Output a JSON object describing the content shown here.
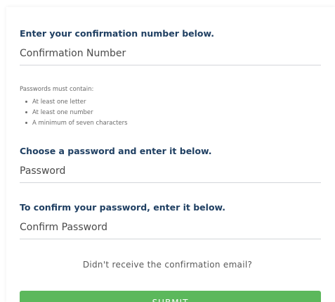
{
  "confirmation": {
    "heading": "Enter your confirmation number below.",
    "placeholder": "Confirmation Number",
    "value": ""
  },
  "password_rules": {
    "title": "Passwords must contain:",
    "items": [
      "At least one letter",
      "At least one number",
      "A minimum of seven characters"
    ]
  },
  "password": {
    "heading": "Choose a password and enter it below.",
    "placeholder": "Password",
    "value": ""
  },
  "confirm_password": {
    "heading": "To confirm your password, enter it below.",
    "placeholder": "Confirm Password",
    "value": ""
  },
  "resend_link": "Didn't receive the confirmation email?",
  "submit_label": "SUBMIT",
  "colors": {
    "heading": "#1f3f62",
    "submit": "#5cb85c",
    "divider": "#d3d6da"
  }
}
